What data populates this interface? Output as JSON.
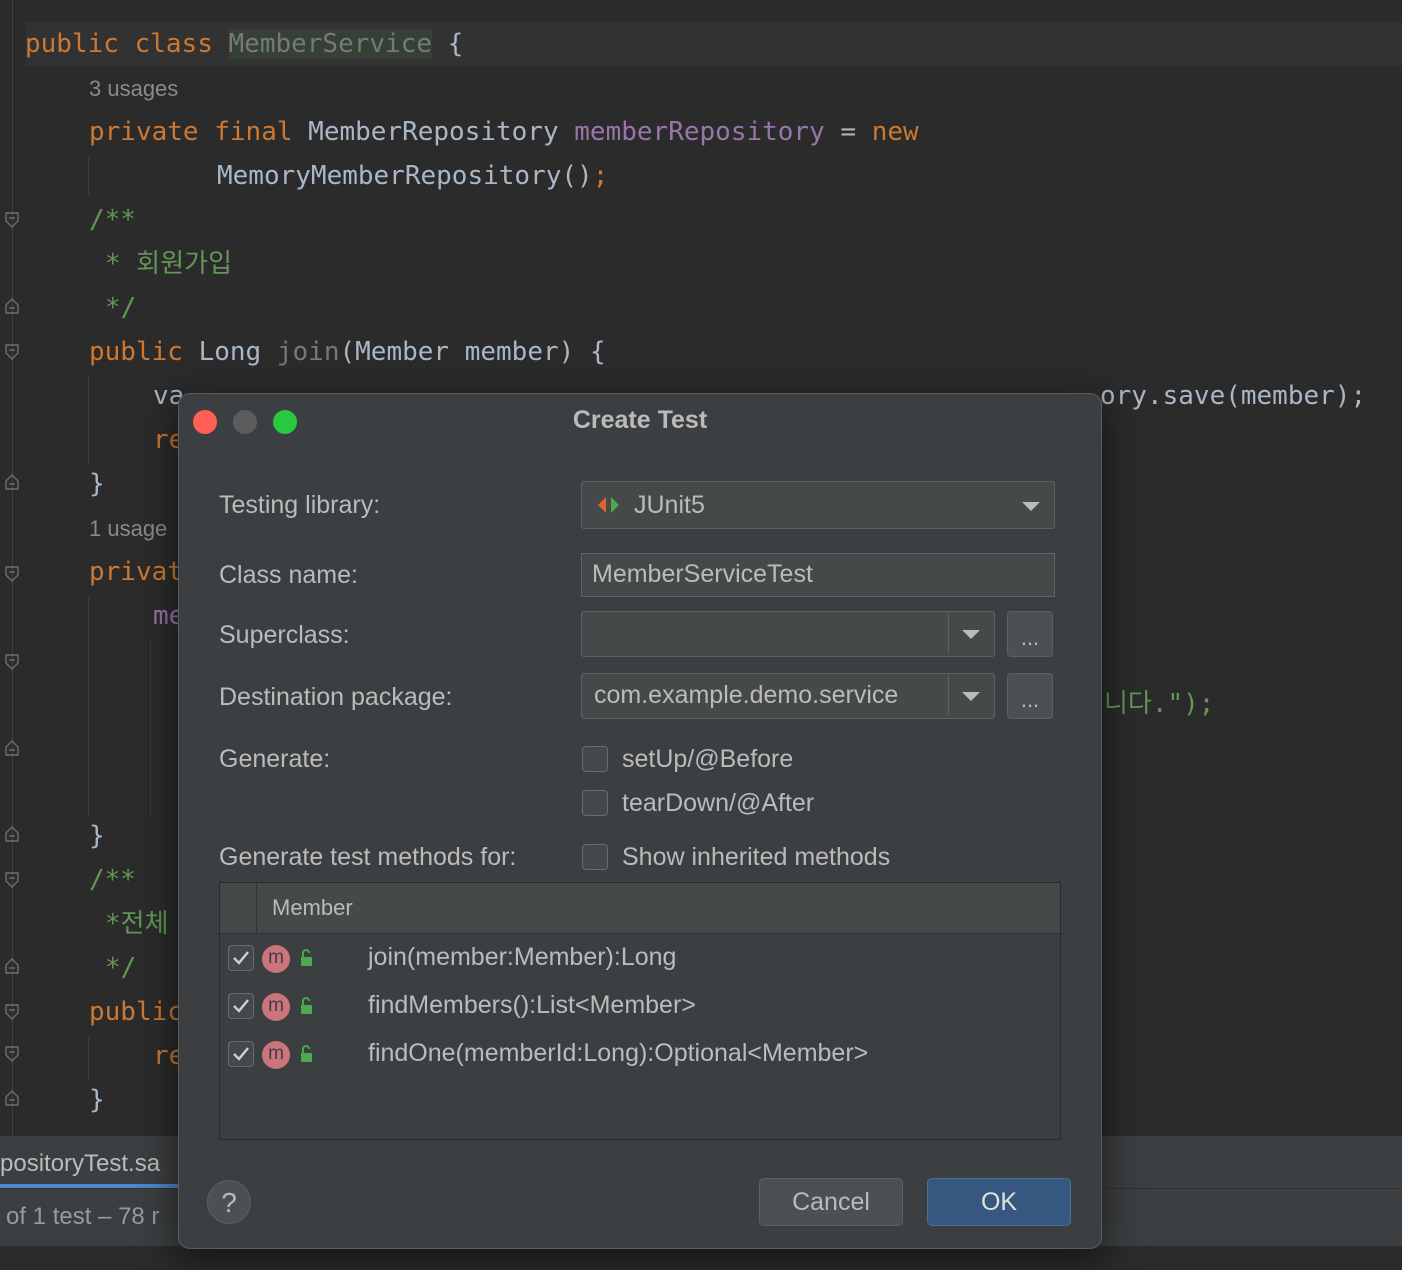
{
  "editor": {
    "line1": {
      "kw1": "public",
      "kw2": "class",
      "cls": "MemberService",
      "brace": "{"
    },
    "usage1": "3 usages",
    "line2": {
      "kw1": "private",
      "kw2": "final",
      "type": "MemberRepository",
      "field": "memberRepository",
      "eq": "=",
      "kw3": "new"
    },
    "line3": {
      "call": "MemoryMemberRepository()",
      "semi": ";"
    },
    "line4": "/**",
    "line5": "* 회원가입",
    "line6": "*/",
    "line7": {
      "kw": "public",
      "type": "Long",
      "fn": "join",
      "params": "(Member member) {"
    },
    "line8_left": "va",
    "line8_right": "ory.save(member);",
    "line9": "re",
    "line10": "}",
    "usage2": "1 usage",
    "line11": "privat",
    "line12": "me",
    "line13_right": "니다.\");",
    "line14": "}",
    "line15": "/**",
    "line16": "*전체",
    "line17": "*/",
    "line18": "public",
    "line19": "re",
    "line20": "}"
  },
  "bottom_panel": {
    "tab_label": "positoryTest.sa",
    "status": "of 1 test – 78 r"
  },
  "dialog": {
    "title": "Create Test",
    "testing_library_label": "Testing library:",
    "testing_library_value": "JUnit5",
    "class_name_label": "Class name:",
    "class_name_value": "MemberServiceTest",
    "superclass_label": "Superclass:",
    "superclass_value": "",
    "destination_label": "Destination package:",
    "destination_value": "com.example.demo.service",
    "browse_label": "...",
    "generate_label": "Generate:",
    "setup_label": "setUp/@Before",
    "teardown_label": "tearDown/@After",
    "methods_for_label": "Generate test methods for:",
    "show_inherited_label": "Show inherited methods",
    "table_header": "Member",
    "method_icon_letter": "m",
    "methods": [
      {
        "label": "join(member:Member):Long",
        "checked": true
      },
      {
        "label": "findMembers():List<Member>",
        "checked": true
      },
      {
        "label": "findOne(memberId:Long):Optional<Member>",
        "checked": true
      }
    ],
    "help_label": "?",
    "cancel_label": "Cancel",
    "ok_label": "OK"
  },
  "colors": {
    "keyword": "#cc7832",
    "field": "#9876aa",
    "comment": "#629755",
    "ok_button": "#365880",
    "close": "#ff5f57",
    "maximize": "#28c840"
  }
}
